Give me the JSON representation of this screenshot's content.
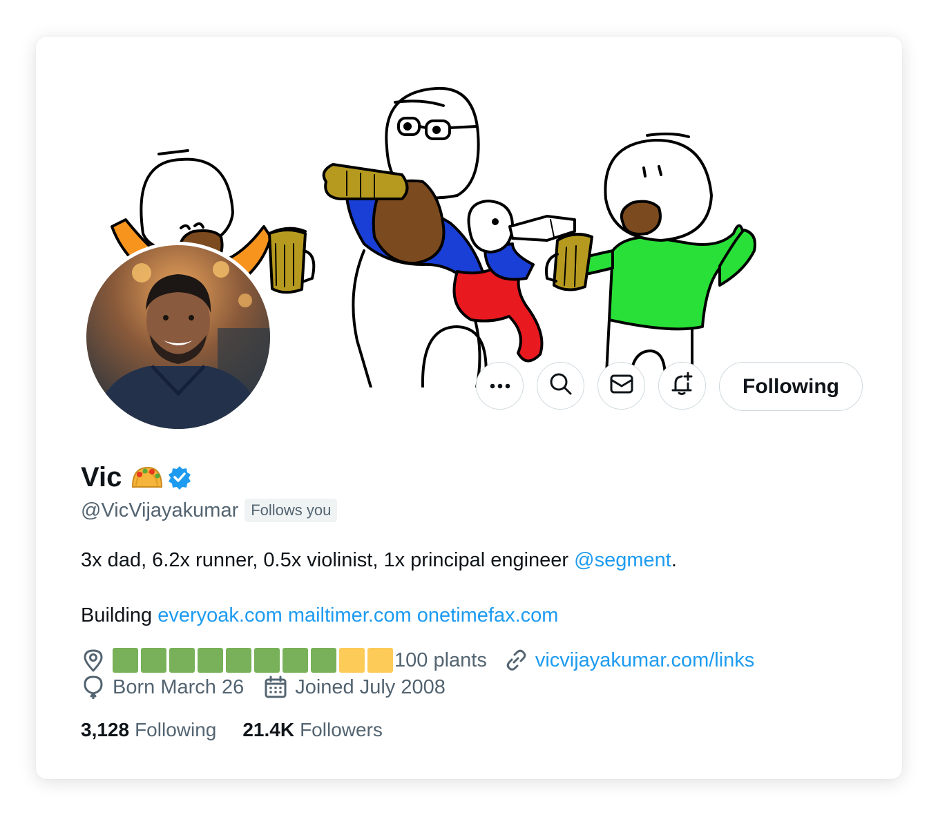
{
  "profile": {
    "name": "Vic",
    "name_emoji": "taco-emoji",
    "verified_badge": "verified-badge-icon",
    "handle": "@VicVijayakumar",
    "follows_you_badge": "Follows you"
  },
  "actions": {
    "more_icon": "more-icon",
    "search_icon": "search-icon",
    "message_icon": "envelope-icon",
    "notify_icon": "bell-plus-icon",
    "following_label": "Following"
  },
  "bio": {
    "line1_text": "3x dad, 6.2x runner, 0.5x violinist, 1x principal engineer ",
    "line1_mention": "@segment",
    "line1_end": ".",
    "line2_prefix": "Building ",
    "line2_links": [
      "everyoak.com",
      "mailtimer.com",
      "onetimefax.com"
    ]
  },
  "meta": {
    "location_icon": "location-pin-icon",
    "location_green_squares": 8,
    "location_yellow_squares": 2,
    "location_suffix": "100 plants",
    "link_icon": "link-icon",
    "website": "vicvijayakumar.com/links",
    "birthday_icon": "balloon-icon",
    "birthday": "Born March 26",
    "joined_icon": "calendar-icon",
    "joined": "Joined July 2008"
  },
  "stats": {
    "following_count": "3,128",
    "following_label": "Following",
    "followers_count": "21.4K",
    "followers_label": "Followers"
  },
  "colors": {
    "link_blue": "#1d9bf0",
    "text_primary": "#0f1419",
    "text_secondary": "#536471",
    "border": "#cfd9de",
    "square_green": "#78b159",
    "square_yellow": "#fdcb58"
  }
}
